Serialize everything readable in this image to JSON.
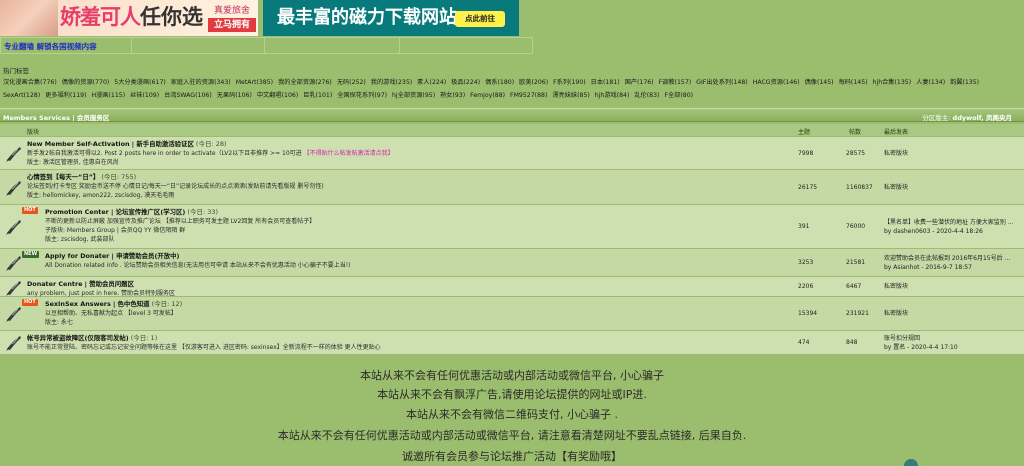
{
  "banners": {
    "ad1": {
      "title_pink": "娇羞可人",
      "title_dark": "任你选",
      "tag_top": "真爱旅舍",
      "tag_btn": "立马拥有"
    },
    "ad2": {
      "title": "最丰富的磁力下载网站",
      "button": "点此前往"
    }
  },
  "topnav": {
    "link": "专业翻墙 解锁各国视频内容"
  },
  "hottags": {
    "title": "热门标签",
    "tags": [
      "汉化漫画合集(776)",
      "偶像的资源(770)",
      "5大分类漫画(617)",
      "家庭入驻的资源(343)",
      "MetArt(385)",
      "我的全部资源(276)",
      "无码(252)",
      "我的游戏(235)",
      "素人(224)",
      "极品(224)",
      "偶系(180)",
      "欧美(206)",
      "F系列(190)",
      "日本(181)",
      "国产(176)",
      "F调教(157)",
      "GIF出处系列(148)",
      "HACG资源(146)",
      "偶像(145)",
      "每码(145)",
      "hjh合集(135)",
      "人妻(134)",
      "韵翼(135)",
      "SexArt(128)",
      "更多福利(119)",
      "H漫画(115)",
      "丝袜(109)",
      "台湾SWAG(106)",
      "无果码(106)",
      "中文翻唱(106)",
      "巨乳(101)",
      "全国探花系列(97)",
      "hj全部资源(95)",
      "熟女(93)",
      "Femjoy(88)",
      "FM9527(88)",
      "漂亮妹妹(85)",
      "hjh游戏(84)",
      "乱伦(83)",
      "F全部(80)"
    ]
  },
  "section": {
    "title": "Members Services | 会员服务区",
    "moderator_prefix": "分区版主: ",
    "moderators": "ddywolf, 凤阁央月"
  },
  "columns": {
    "forum": "版块",
    "topics": "主题",
    "posts": "帖数",
    "last": "最后发表"
  },
  "forums": [
    {
      "name": "New Member Self-Activation | 新手自助激活验证区",
      "today": " (今日: 28)",
      "desc": "新手发2帖自我激活可得以2. Post 2 posts here in order to activate（LV2以下且非推荐 >= 10可进",
      "desc_pink": "【不得贴什么帖发帖激活请点我】",
      "mod": "版主: 激活区管理员, 佳惠自在风尚",
      "topics": "7998",
      "posts": "28575",
      "last1": "私密版块",
      "last2": ""
    },
    {
      "name": "心情签到【每天一“日”】",
      "today": " (今日: 755)",
      "desc": "论坛签到/打卡专区 奖励金币送不停 心情日记/每天一“日”记录论坛成长的点点滴滴(发贴前请先看版规 删号勿怪)",
      "desc_pink": "",
      "mod": "版主: hellomickey, amon222, zscisdog, 漠天毛毛雨",
      "topics": "26175",
      "posts": "1160837",
      "last1": "私密版块",
      "last2": ""
    },
    {
      "name": "Promotion Center | 论坛宣传推广区(学习区)",
      "today": " (今日: 33)",
      "desc": "不断的更新以防止屏蔽 加强宣传及推广论坛 【推荐以上职务可发主题 LV2回复 所有会员可查看帖子】",
      "desc_pink": "",
      "mod": "子版块: Members Group | 会员QQ YY 微信陌陌 群",
      "mod2": "版主: zscisdog, 武装部队",
      "topics": "391",
      "posts": "76000",
      "last1": "【黑名单】收费一些潜伏的地址 方便大家监别 ...",
      "last2": "by dashen0603 - 2020-4-4 18:26"
    },
    {
      "name": "Apply for Donater | 申请赞助会员(开放中)",
      "today": "",
      "desc": "All Donation related info . 论坛赞助会员相关信息(无法用也可申请 本站从来不会有优惠活动 小心骗子不要上当!)",
      "desc_pink": "",
      "mod": "",
      "topics": "3253",
      "posts": "21581",
      "last1": "欢迎赞助会员在此帖报到 2016年6月15号后 ...",
      "last2": "by Asianhot - 2016-9-7 18:57"
    },
    {
      "name": "Donater Centre | 赞助会员问题区",
      "today": "",
      "desc": "any problem, just post in here.   赞助会员特别服务区",
      "desc_pink": "",
      "mod": "",
      "topics": "2206",
      "posts": "6467",
      "last1": "私密版块",
      "last2": ""
    },
    {
      "name": "SexInSex Answers | 色中色知道",
      "today": " (今日: 12)",
      "desc": "以豆相帮助、无私喜献为起点   【level 3 可发帖】",
      "desc_pink": "",
      "mod": "版主: 永七",
      "topics": "15394",
      "posts": "231921",
      "last1": "私密版块",
      "last2": ""
    },
    {
      "name": "帐号异常被盗故障区(仅限客司发帖)",
      "today": " (今日: 1)",
      "desc": "账号不能正常登陆、密码忘记或忘记安全问题等帐在这里 【仅游客可进入 进区密码: sexinsex】全新流程不一样的体验 更人性更贴心",
      "desc_pink": "",
      "mod": "",
      "topics": "474",
      "posts": "848",
      "last1": "账号扣分规回",
      "last2": "by 置名 - 2020-4-4 17:10"
    }
  ],
  "notices": [
    "本站从来不会有任何优惠活动或内部活动或微信平台, 小心骗子",
    "本站从来不会有飘浮广告,请使用论坛提供的网址或IP进.",
    "本站从来不会有微信二维码支付, 小心骗子 .",
    "本站从来不会有任何优惠活动或内部活动或微信平台, 请注意看清楚网址不要乱点链接, 后果自负.",
    "诚邀所有会员参与论坛推广活动【有奖励哦】"
  ]
}
